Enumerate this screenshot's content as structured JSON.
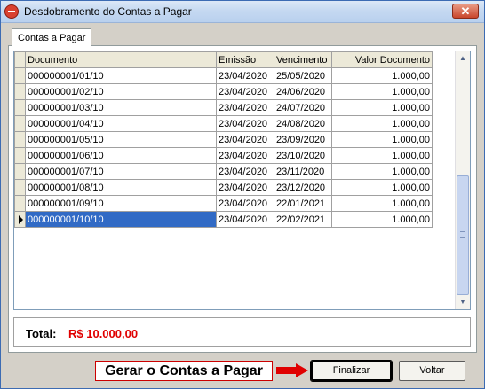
{
  "window": {
    "title": "Desdobramento do Contas a Pagar",
    "close_symbol": "✕"
  },
  "tabs": [
    {
      "label": "Contas a Pagar"
    }
  ],
  "grid": {
    "columns": [
      "Documento",
      "Emissão",
      "Vencimento",
      "Valor Documento"
    ],
    "rows": [
      {
        "documento": "000000001/01/10",
        "emissao": "23/04/2020",
        "vencimento": "25/05/2020",
        "valor": "1.000,00"
      },
      {
        "documento": "000000001/02/10",
        "emissao": "23/04/2020",
        "vencimento": "24/06/2020",
        "valor": "1.000,00"
      },
      {
        "documento": "000000001/03/10",
        "emissao": "23/04/2020",
        "vencimento": "24/07/2020",
        "valor": "1.000,00"
      },
      {
        "documento": "000000001/04/10",
        "emissao": "23/04/2020",
        "vencimento": "24/08/2020",
        "valor": "1.000,00"
      },
      {
        "documento": "000000001/05/10",
        "emissao": "23/04/2020",
        "vencimento": "23/09/2020",
        "valor": "1.000,00"
      },
      {
        "documento": "000000001/06/10",
        "emissao": "23/04/2020",
        "vencimento": "23/10/2020",
        "valor": "1.000,00"
      },
      {
        "documento": "000000001/07/10",
        "emissao": "23/04/2020",
        "vencimento": "23/11/2020",
        "valor": "1.000,00"
      },
      {
        "documento": "000000001/08/10",
        "emissao": "23/04/2020",
        "vencimento": "23/12/2020",
        "valor": "1.000,00"
      },
      {
        "documento": "000000001/09/10",
        "emissao": "23/04/2020",
        "vencimento": "22/01/2021",
        "valor": "1.000,00"
      },
      {
        "documento": "000000001/10/10",
        "emissao": "23/04/2020",
        "vencimento": "22/02/2021",
        "valor": "1.000,00"
      }
    ],
    "selected_row": 9
  },
  "total": {
    "label": "Total:",
    "value": "R$ 10.000,00"
  },
  "annotation": {
    "text": "Gerar o Contas a Pagar",
    "color": "#cc0000"
  },
  "buttons": {
    "finalizar": "Finalizar",
    "voltar": "Voltar"
  }
}
